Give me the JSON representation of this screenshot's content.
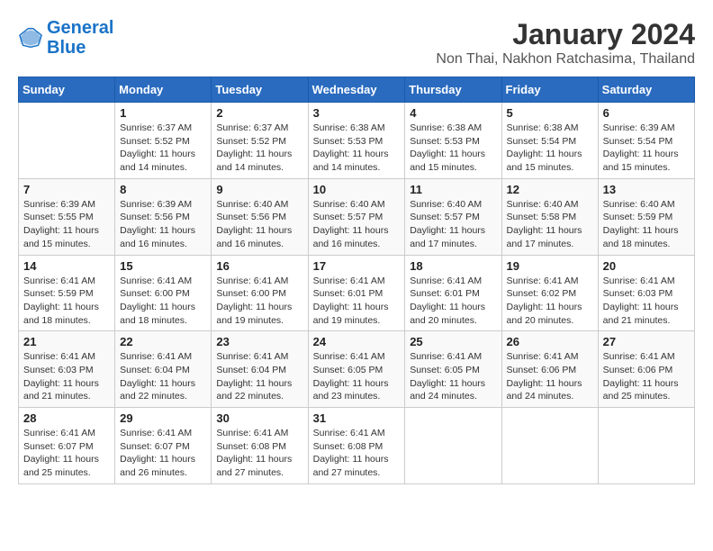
{
  "header": {
    "logo_line1": "General",
    "logo_line2": "Blue",
    "main_title": "January 2024",
    "subtitle": "Non Thai, Nakhon Ratchasima, Thailand"
  },
  "calendar": {
    "days_of_week": [
      "Sunday",
      "Monday",
      "Tuesday",
      "Wednesday",
      "Thursday",
      "Friday",
      "Saturday"
    ],
    "weeks": [
      [
        {
          "day": "",
          "info": ""
        },
        {
          "day": "1",
          "info": "Sunrise: 6:37 AM\nSunset: 5:52 PM\nDaylight: 11 hours\nand 14 minutes."
        },
        {
          "day": "2",
          "info": "Sunrise: 6:37 AM\nSunset: 5:52 PM\nDaylight: 11 hours\nand 14 minutes."
        },
        {
          "day": "3",
          "info": "Sunrise: 6:38 AM\nSunset: 5:53 PM\nDaylight: 11 hours\nand 14 minutes."
        },
        {
          "day": "4",
          "info": "Sunrise: 6:38 AM\nSunset: 5:53 PM\nDaylight: 11 hours\nand 15 minutes."
        },
        {
          "day": "5",
          "info": "Sunrise: 6:38 AM\nSunset: 5:54 PM\nDaylight: 11 hours\nand 15 minutes."
        },
        {
          "day": "6",
          "info": "Sunrise: 6:39 AM\nSunset: 5:54 PM\nDaylight: 11 hours\nand 15 minutes."
        }
      ],
      [
        {
          "day": "7",
          "info": "Sunrise: 6:39 AM\nSunset: 5:55 PM\nDaylight: 11 hours\nand 15 minutes."
        },
        {
          "day": "8",
          "info": "Sunrise: 6:39 AM\nSunset: 5:56 PM\nDaylight: 11 hours\nand 16 minutes."
        },
        {
          "day": "9",
          "info": "Sunrise: 6:40 AM\nSunset: 5:56 PM\nDaylight: 11 hours\nand 16 minutes."
        },
        {
          "day": "10",
          "info": "Sunrise: 6:40 AM\nSunset: 5:57 PM\nDaylight: 11 hours\nand 16 minutes."
        },
        {
          "day": "11",
          "info": "Sunrise: 6:40 AM\nSunset: 5:57 PM\nDaylight: 11 hours\nand 17 minutes."
        },
        {
          "day": "12",
          "info": "Sunrise: 6:40 AM\nSunset: 5:58 PM\nDaylight: 11 hours\nand 17 minutes."
        },
        {
          "day": "13",
          "info": "Sunrise: 6:40 AM\nSunset: 5:59 PM\nDaylight: 11 hours\nand 18 minutes."
        }
      ],
      [
        {
          "day": "14",
          "info": "Sunrise: 6:41 AM\nSunset: 5:59 PM\nDaylight: 11 hours\nand 18 minutes."
        },
        {
          "day": "15",
          "info": "Sunrise: 6:41 AM\nSunset: 6:00 PM\nDaylight: 11 hours\nand 18 minutes."
        },
        {
          "day": "16",
          "info": "Sunrise: 6:41 AM\nSunset: 6:00 PM\nDaylight: 11 hours\nand 19 minutes."
        },
        {
          "day": "17",
          "info": "Sunrise: 6:41 AM\nSunset: 6:01 PM\nDaylight: 11 hours\nand 19 minutes."
        },
        {
          "day": "18",
          "info": "Sunrise: 6:41 AM\nSunset: 6:01 PM\nDaylight: 11 hours\nand 20 minutes."
        },
        {
          "day": "19",
          "info": "Sunrise: 6:41 AM\nSunset: 6:02 PM\nDaylight: 11 hours\nand 20 minutes."
        },
        {
          "day": "20",
          "info": "Sunrise: 6:41 AM\nSunset: 6:03 PM\nDaylight: 11 hours\nand 21 minutes."
        }
      ],
      [
        {
          "day": "21",
          "info": "Sunrise: 6:41 AM\nSunset: 6:03 PM\nDaylight: 11 hours\nand 21 minutes."
        },
        {
          "day": "22",
          "info": "Sunrise: 6:41 AM\nSunset: 6:04 PM\nDaylight: 11 hours\nand 22 minutes."
        },
        {
          "day": "23",
          "info": "Sunrise: 6:41 AM\nSunset: 6:04 PM\nDaylight: 11 hours\nand 22 minutes."
        },
        {
          "day": "24",
          "info": "Sunrise: 6:41 AM\nSunset: 6:05 PM\nDaylight: 11 hours\nand 23 minutes."
        },
        {
          "day": "25",
          "info": "Sunrise: 6:41 AM\nSunset: 6:05 PM\nDaylight: 11 hours\nand 24 minutes."
        },
        {
          "day": "26",
          "info": "Sunrise: 6:41 AM\nSunset: 6:06 PM\nDaylight: 11 hours\nand 24 minutes."
        },
        {
          "day": "27",
          "info": "Sunrise: 6:41 AM\nSunset: 6:06 PM\nDaylight: 11 hours\nand 25 minutes."
        }
      ],
      [
        {
          "day": "28",
          "info": "Sunrise: 6:41 AM\nSunset: 6:07 PM\nDaylight: 11 hours\nand 25 minutes."
        },
        {
          "day": "29",
          "info": "Sunrise: 6:41 AM\nSunset: 6:07 PM\nDaylight: 11 hours\nand 26 minutes."
        },
        {
          "day": "30",
          "info": "Sunrise: 6:41 AM\nSunset: 6:08 PM\nDaylight: 11 hours\nand 27 minutes."
        },
        {
          "day": "31",
          "info": "Sunrise: 6:41 AM\nSunset: 6:08 PM\nDaylight: 11 hours\nand 27 minutes."
        },
        {
          "day": "",
          "info": ""
        },
        {
          "day": "",
          "info": ""
        },
        {
          "day": "",
          "info": ""
        }
      ]
    ]
  }
}
